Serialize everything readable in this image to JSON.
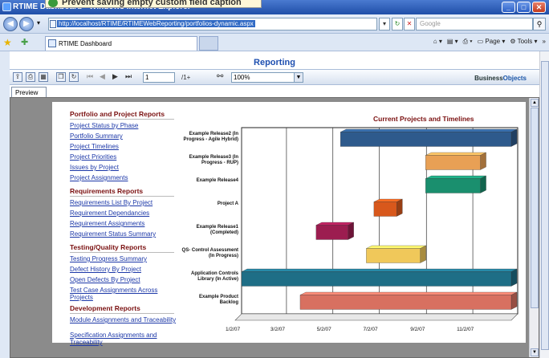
{
  "window": {
    "title": "RTIME Dashboard - Windows Internet Explorer",
    "tooltip_overlay": "Prevent saving empty custom field caption",
    "address": "http://localhost/RTIME/RTIMEWebReporting/portfolios-dynamic.aspx",
    "search_placeholder": "Google",
    "tab_title": "RTIME Dashboard",
    "cmd_page": "Page",
    "cmd_tools": "Tools"
  },
  "report": {
    "title": "Reporting",
    "page_current": "1",
    "page_total": "/1+",
    "zoom": "100%",
    "logo_a": "Business",
    "logo_b": "Objects",
    "preview_tab": "Preview"
  },
  "sections": [
    {
      "title": "Portfolio and Project Reports",
      "links": [
        "Project Status by Phase",
        "Portfolio Summary",
        "Project Timelines",
        "Project Priorities",
        "Issues by Project",
        "Project Assignments"
      ]
    },
    {
      "title": "Requirements Reports",
      "links": [
        "Requirements List By Project",
        "Requirement Dependancies",
        "Requirement Assignments",
        "Requirement Status Summary"
      ]
    },
    {
      "title": "Testing/Quality Reports",
      "links": [
        "Testing Progress Summary",
        "Defect History By Project",
        "Open Defects By Project",
        "Test Case Assignments Across Projects"
      ]
    },
    {
      "title": "Development Reports",
      "links": [
        "Module Assignments and Traceability",
        "Specification Assignments and Traceability"
      ]
    }
  ],
  "chart_data": {
    "type": "bar",
    "orientation": "horizontal-gantt",
    "title": "Current Projects and Timelines",
    "x_ticks": [
      "1/2/07",
      "3/2/07",
      "5/2/07",
      "7/2/07",
      "9/2/07",
      "11/2/07"
    ],
    "xlim": [
      "1/2/07",
      "12/31/07"
    ],
    "series": [
      {
        "label": "Example Release2 (In Progress - Agile Hybrid)",
        "start": "5/12/07",
        "end": "12/31/07",
        "color": "#2e5a8c"
      },
      {
        "label": "Example Release3 (In Progress - RUP)",
        "start": "9/1/07",
        "end": "11/12/07",
        "color": "#e8a055"
      },
      {
        "label": "Example Release4",
        "start": "9/1/07",
        "end": "11/12/07",
        "color": "#1a8f6e"
      },
      {
        "label": "Project A",
        "start": "6/25/07",
        "end": "7/25/07",
        "color": "#d8581c"
      },
      {
        "label": "Example Release1 (Completed)",
        "start": "4/10/07",
        "end": "5/22/07",
        "color": "#9c1d50"
      },
      {
        "label": "QS- Control Assessment (In Progress)",
        "start": "6/15/07",
        "end": "8/25/07",
        "color": "#f0c85a"
      },
      {
        "label": "Application Controls Library (In Active)",
        "start": "1/2/07",
        "end": "12/31/07",
        "color": "#1e6e86"
      },
      {
        "label": "Example Product Backlog",
        "start": "3/20/07",
        "end": "12/31/07",
        "color": "#d87060"
      }
    ]
  }
}
